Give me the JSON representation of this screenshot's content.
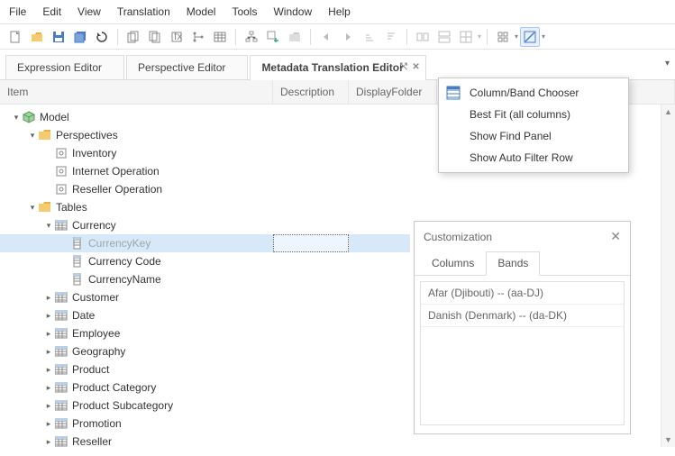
{
  "menu": {
    "items": [
      "File",
      "Edit",
      "View",
      "Translation",
      "Model",
      "Tools",
      "Window",
      "Help"
    ]
  },
  "tabs": {
    "items": [
      {
        "label": "Expression Editor",
        "active": false
      },
      {
        "label": "Perspective Editor",
        "active": false
      },
      {
        "label": "Metadata Translation Editor",
        "active": true
      }
    ]
  },
  "grid": {
    "cols": [
      "Item",
      "Description",
      "DisplayFolder"
    ]
  },
  "tree": [
    {
      "depth": 0,
      "arrow": "open",
      "icon": "model",
      "label": "Model"
    },
    {
      "depth": 1,
      "arrow": "open",
      "icon": "folder",
      "label": "Perspectives"
    },
    {
      "depth": 2,
      "arrow": "none",
      "icon": "persp",
      "label": "Inventory"
    },
    {
      "depth": 2,
      "arrow": "none",
      "icon": "persp",
      "label": "Internet Operation"
    },
    {
      "depth": 2,
      "arrow": "none",
      "icon": "persp",
      "label": "Reseller Operation"
    },
    {
      "depth": 1,
      "arrow": "open",
      "icon": "folder",
      "label": "Tables"
    },
    {
      "depth": 2,
      "arrow": "open",
      "icon": "table",
      "label": "Currency"
    },
    {
      "depth": 3,
      "arrow": "none",
      "icon": "column",
      "label": "CurrencyKey",
      "selected": true,
      "dim": true
    },
    {
      "depth": 3,
      "arrow": "none",
      "icon": "column",
      "label": "Currency Code"
    },
    {
      "depth": 3,
      "arrow": "none",
      "icon": "column",
      "label": "CurrencyName"
    },
    {
      "depth": 2,
      "arrow": "closed",
      "icon": "table",
      "label": "Customer"
    },
    {
      "depth": 2,
      "arrow": "closed",
      "icon": "table",
      "label": "Date"
    },
    {
      "depth": 2,
      "arrow": "closed",
      "icon": "table",
      "label": "Employee"
    },
    {
      "depth": 2,
      "arrow": "closed",
      "icon": "table",
      "label": "Geography"
    },
    {
      "depth": 2,
      "arrow": "closed",
      "icon": "table",
      "label": "Product"
    },
    {
      "depth": 2,
      "arrow": "closed",
      "icon": "table",
      "label": "Product Category"
    },
    {
      "depth": 2,
      "arrow": "closed",
      "icon": "table",
      "label": "Product Subcategory"
    },
    {
      "depth": 2,
      "arrow": "closed",
      "icon": "table",
      "label": "Promotion"
    },
    {
      "depth": 2,
      "arrow": "closed",
      "icon": "table",
      "label": "Reseller"
    }
  ],
  "context_menu": {
    "items": [
      {
        "label": "Column/Band Chooser",
        "icon": true
      },
      {
        "label": "Best Fit (all columns)"
      },
      {
        "label": "Show Find Panel"
      },
      {
        "label": "Show Auto Filter Row"
      }
    ]
  },
  "custom": {
    "title": "Customization",
    "tabs": [
      "Columns",
      "Bands"
    ],
    "active_tab": "Bands",
    "bands": [
      "Afar (Djibouti) -- (aa-DJ)",
      "Danish (Denmark) -- (da-DK)"
    ]
  }
}
